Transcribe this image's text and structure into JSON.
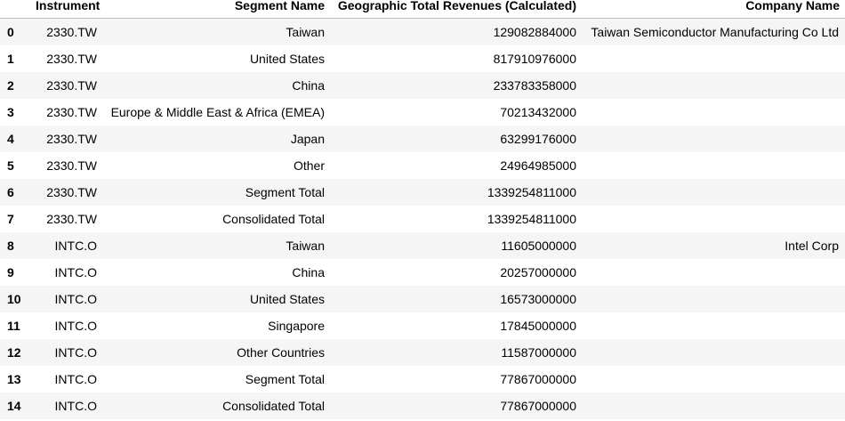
{
  "columns": [
    "",
    "Instrument",
    "Segment Name",
    "Geographic Total Revenues (Calculated)",
    "Company Name"
  ],
  "rows": [
    {
      "index": "0",
      "instrument": "2330.TW",
      "segment": "Taiwan",
      "revenue": "129082884000",
      "company": "Taiwan Semiconductor Manufacturing Co Ltd"
    },
    {
      "index": "1",
      "instrument": "2330.TW",
      "segment": "United States",
      "revenue": "817910976000",
      "company": ""
    },
    {
      "index": "2",
      "instrument": "2330.TW",
      "segment": "China",
      "revenue": "233783358000",
      "company": ""
    },
    {
      "index": "3",
      "instrument": "2330.TW",
      "segment": "Europe & Middle East & Africa (EMEA)",
      "revenue": "70213432000",
      "company": ""
    },
    {
      "index": "4",
      "instrument": "2330.TW",
      "segment": "Japan",
      "revenue": "63299176000",
      "company": ""
    },
    {
      "index": "5",
      "instrument": "2330.TW",
      "segment": "Other",
      "revenue": "24964985000",
      "company": ""
    },
    {
      "index": "6",
      "instrument": "2330.TW",
      "segment": "Segment Total",
      "revenue": "1339254811000",
      "company": ""
    },
    {
      "index": "7",
      "instrument": "2330.TW",
      "segment": "Consolidated Total",
      "revenue": "1339254811000",
      "company": ""
    },
    {
      "index": "8",
      "instrument": "INTC.O",
      "segment": "Taiwan",
      "revenue": "11605000000",
      "company": "Intel Corp"
    },
    {
      "index": "9",
      "instrument": "INTC.O",
      "segment": "China",
      "revenue": "20257000000",
      "company": ""
    },
    {
      "index": "10",
      "instrument": "INTC.O",
      "segment": "United States",
      "revenue": "16573000000",
      "company": ""
    },
    {
      "index": "11",
      "instrument": "INTC.O",
      "segment": "Singapore",
      "revenue": "17845000000",
      "company": ""
    },
    {
      "index": "12",
      "instrument": "INTC.O",
      "segment": "Other Countries",
      "revenue": "11587000000",
      "company": ""
    },
    {
      "index": "13",
      "instrument": "INTC.O",
      "segment": "Segment Total",
      "revenue": "77867000000",
      "company": ""
    },
    {
      "index": "14",
      "instrument": "INTC.O",
      "segment": "Consolidated Total",
      "revenue": "77867000000",
      "company": ""
    }
  ]
}
